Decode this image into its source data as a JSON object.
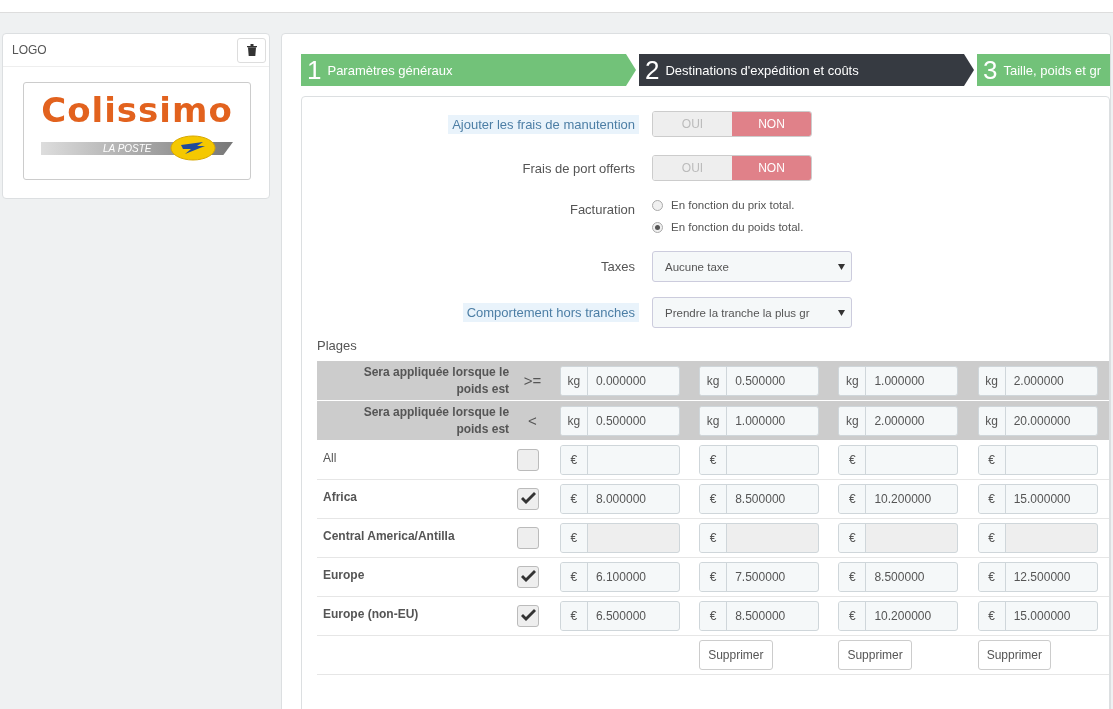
{
  "logo_panel": {
    "title": "LOGO",
    "logo_text": "Colissimo",
    "logo_band_text": "LA POSTE"
  },
  "steps": [
    {
      "number": "1",
      "label": "Paramètres généraux",
      "selected": false
    },
    {
      "number": "2",
      "label": "Destinations d'expédition et coûts",
      "selected": true
    },
    {
      "number": "3",
      "label": "Taille, poids et gr",
      "selected": false
    }
  ],
  "fields": [
    {
      "kind": "toggle",
      "label": "Ajouter les frais de manutention",
      "highlighted": true,
      "options": [
        {
          "label": "OUI",
          "selected": false
        },
        {
          "label": "NON",
          "selected": true
        }
      ]
    },
    {
      "kind": "toggle",
      "label": "Frais de port offerts",
      "highlighted": false,
      "options": [
        {
          "label": "OUI",
          "selected": false
        },
        {
          "label": "NON",
          "selected": true
        }
      ]
    },
    {
      "kind": "radio",
      "label": "Facturation",
      "highlighted": false,
      "options": [
        {
          "label": "En fonction du prix total.",
          "selected": false
        },
        {
          "label": "En fonction du poids total.",
          "selected": true
        }
      ]
    },
    {
      "kind": "select",
      "label": "Taxes",
      "highlighted": false,
      "value": "Aucune taxe"
    },
    {
      "kind": "select",
      "label": "Comportement hors tranches",
      "highlighted": true,
      "value": "Prendre la tranche la plus gr"
    }
  ],
  "ranges": {
    "title": "Plages",
    "bounds": [
      {
        "label": "Sera appliquée lorsque le poids est",
        "operator": ">=",
        "cells": [
          {
            "unit": "kg",
            "value": "0.000000"
          },
          {
            "unit": "kg",
            "value": "0.500000"
          },
          {
            "unit": "kg",
            "value": "1.000000"
          },
          {
            "unit": "kg",
            "value": "2.000000"
          }
        ]
      },
      {
        "label": "Sera appliquée lorsque le poids est",
        "operator": "<",
        "cells": [
          {
            "unit": "kg",
            "value": "0.500000"
          },
          {
            "unit": "kg",
            "value": "1.000000"
          },
          {
            "unit": "kg",
            "value": "2.000000"
          },
          {
            "unit": "kg",
            "value": "20.000000"
          }
        ]
      }
    ],
    "zones": [
      {
        "kind": "all",
        "name": "All",
        "checked": false,
        "prices": [
          {
            "unit": "€"
          },
          {
            "unit": "€"
          },
          {
            "unit": "€"
          },
          {
            "unit": "€"
          }
        ]
      },
      {
        "kind": "zone",
        "name": "Africa",
        "checked": true,
        "prices": [
          {
            "unit": "€",
            "value": "8.000000"
          },
          {
            "unit": "€",
            "value": "8.500000"
          },
          {
            "unit": "€",
            "value": "10.200000"
          },
          {
            "unit": "€",
            "value": "15.000000"
          }
        ]
      },
      {
        "kind": "zone",
        "name": "Central America/Antilla",
        "checked": false,
        "prices": [
          {
            "unit": "€"
          },
          {
            "unit": "€"
          },
          {
            "unit": "€"
          },
          {
            "unit": "€"
          }
        ]
      },
      {
        "kind": "zone",
        "name": "Europe",
        "checked": true,
        "prices": [
          {
            "unit": "€",
            "value": "6.100000"
          },
          {
            "unit": "€",
            "value": "7.500000"
          },
          {
            "unit": "€",
            "value": "8.500000"
          },
          {
            "unit": "€",
            "value": "12.500000"
          }
        ]
      },
      {
        "kind": "zone",
        "name": "Europe (non-EU)",
        "checked": true,
        "prices": [
          {
            "unit": "€",
            "value": "6.500000"
          },
          {
            "unit": "€",
            "value": "8.500000"
          },
          {
            "unit": "€",
            "value": "10.200000"
          },
          {
            "unit": "€",
            "value": "15.000000"
          }
        ]
      }
    ],
    "delete_buttons": [
      "Supprimer",
      "Supprimer",
      "Supprimer"
    ]
  }
}
